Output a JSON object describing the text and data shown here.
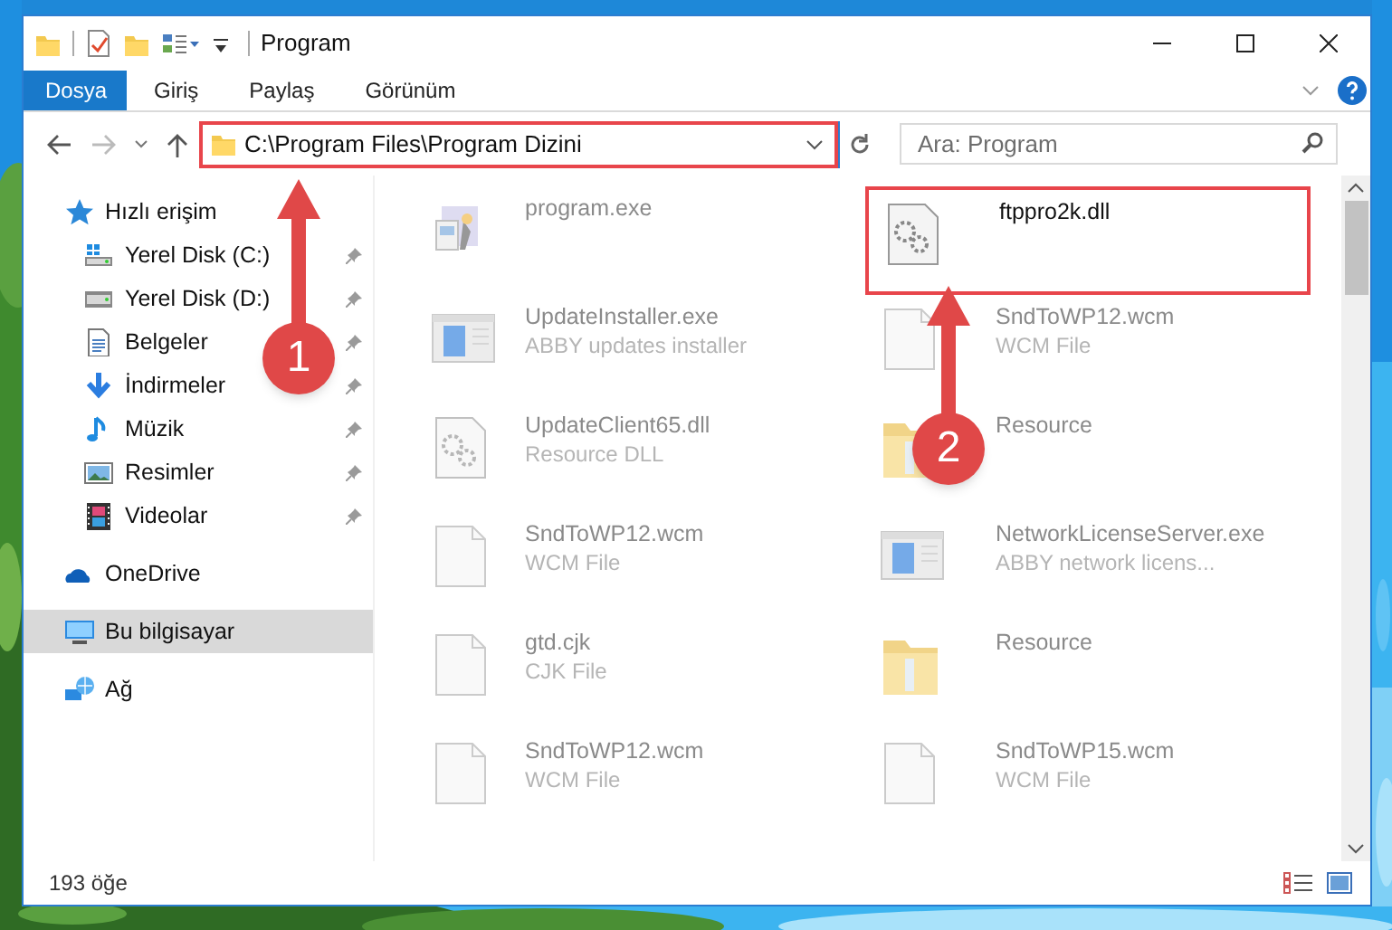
{
  "window": {
    "title": "Program"
  },
  "ribbon_tabs": [
    {
      "label": "Dosya",
      "selected": true
    },
    {
      "label": "Giriş",
      "selected": false
    },
    {
      "label": "Paylaş",
      "selected": false
    },
    {
      "label": "Görünüm",
      "selected": false
    }
  ],
  "address_bar": {
    "path": "C:\\Program Files\\Program Dizini",
    "highlighted": true
  },
  "search": {
    "placeholder": "Ara: Program"
  },
  "navigation": [
    {
      "label": "Hızlı erişim",
      "kind": "quick",
      "selected": false,
      "children": [
        {
          "label": "Yerel Disk (C:)",
          "kind": "drive-c",
          "pinned": true
        },
        {
          "label": "Yerel Disk (D:)",
          "kind": "drive",
          "pinned": true
        },
        {
          "label": "Belgeler",
          "kind": "documents",
          "pinned": true
        },
        {
          "label": "İndirmeler",
          "kind": "downloads",
          "pinned": true
        },
        {
          "label": "Müzik",
          "kind": "music",
          "pinned": true
        },
        {
          "label": "Resimler",
          "kind": "pictures",
          "pinned": true
        },
        {
          "label": "Videolar",
          "kind": "videos",
          "pinned": true
        }
      ]
    },
    {
      "label": "OneDrive",
      "kind": "cloud",
      "selected": false
    },
    {
      "label": "Bu bilgisayar",
      "kind": "computer",
      "selected": true
    },
    {
      "label": "Ağ",
      "kind": "network",
      "selected": false
    }
  ],
  "files": [
    {
      "name": "program.exe",
      "kind": "setup",
      "blurred": true,
      "highlighted": false
    },
    {
      "name": "ftppro2k.dll",
      "kind": "dll",
      "blurred": false,
      "highlighted": true
    },
    {
      "name": "UpdateInstaller.exe",
      "type": "ABBY updates installer",
      "kind": "app",
      "blurred": true,
      "highlighted": false
    },
    {
      "name": "SndToWP12.wcm",
      "type": "WCM File",
      "kind": "file",
      "blurred": true,
      "highlighted": false
    },
    {
      "name": "UpdateClient65.dll",
      "type": "Resource DLL",
      "kind": "dll",
      "blurred": true,
      "highlighted": false
    },
    {
      "name": "Resource",
      "kind": "folder",
      "blurred": true,
      "highlighted": false
    },
    {
      "name": "SndToWP12.wcm",
      "type": "WCM File",
      "kind": "file",
      "blurred": true,
      "highlighted": false
    },
    {
      "name": "NetworkLicenseServer.exe",
      "type": "ABBY network licens...",
      "kind": "app",
      "blurred": true,
      "highlighted": false
    },
    {
      "name": "gtd.cjk",
      "type": "CJK File",
      "kind": "file",
      "blurred": true,
      "highlighted": false
    },
    {
      "name": "Resource",
      "kind": "folder",
      "blurred": true,
      "highlighted": false
    },
    {
      "name": "SndToWP12.wcm",
      "type": "WCM File",
      "kind": "file",
      "blurred": true,
      "highlighted": false
    },
    {
      "name": "SndToWP15.wcm",
      "type": "WCM File",
      "kind": "file",
      "blurred": true,
      "highlighted": false
    }
  ],
  "status_bar": {
    "item_count": "193 öğe"
  },
  "annotations": [
    {
      "label": "1"
    },
    {
      "label": "2"
    }
  ]
}
